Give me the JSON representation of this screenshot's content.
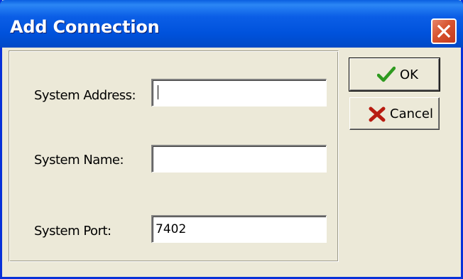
{
  "window": {
    "title": "Add Connection",
    "close_icon": "close-icon"
  },
  "form": {
    "address_label": "System Address:",
    "address_value": "",
    "name_label": "System Name:",
    "name_value": "",
    "port_label": "System Port:",
    "port_value": "7402"
  },
  "buttons": {
    "ok_label": "OK",
    "ok_icon": "checkmark-icon",
    "cancel_label": "Cancel",
    "cancel_icon": "x-icon"
  },
  "colors": {
    "titlebar": "#0052dc",
    "ok_icon": "#2e9a1f",
    "cancel_icon": "#b81b10"
  }
}
